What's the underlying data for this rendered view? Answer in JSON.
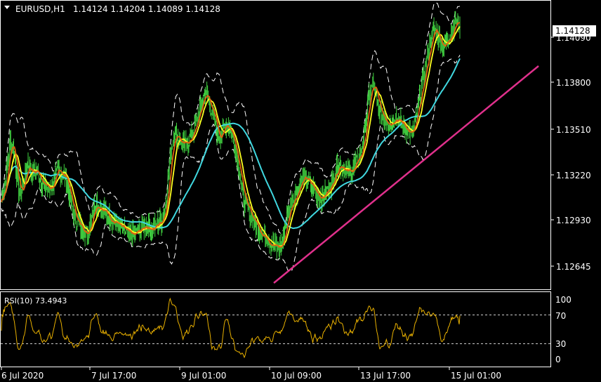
{
  "header": {
    "symbol": "EURUSD,H1",
    "ohlc": "1.14124 1.14204 1.14089 1.14128"
  },
  "rsi_header": {
    "label": "RSI(10) 73.4943"
  },
  "colors": {
    "background": "#000000",
    "grid": "#ffffff",
    "candle": "#40d040",
    "ma_fast": "#e06010",
    "ma_slow": "#ffff20",
    "ma_long": "#40d8e0",
    "bollinger": "#ffffff",
    "trendline": "#e0308c",
    "rsi_line": "#e8b000",
    "price_tag_bg": "#ffffff",
    "price_tag_fg": "#000000"
  },
  "chart_data": {
    "type": "candlestick",
    "price_axis": {
      "ticks": [
        "1.14090",
        "1.13800",
        "1.13510",
        "1.13220",
        "1.12930",
        "1.12645"
      ],
      "current_price": "1.14128",
      "ylim": [
        1.1245,
        1.1427
      ]
    },
    "time_axis": {
      "labels": [
        "6 Jul 2020",
        "7 Jul 17:00",
        "9 Jul 01:00",
        "10 Jul 09:00",
        "13 Jul 17:00",
        "15 Jul 01:00"
      ]
    },
    "rsi": {
      "period": 10,
      "last_value": 73.4943,
      "levels": [
        "100",
        "70",
        "30",
        "0"
      ],
      "ylim": [
        0,
        100
      ]
    },
    "approx_close_path": [
      1.13,
      1.1315,
      1.134,
      1.133,
      1.1305,
      1.131,
      1.1325,
      1.1318,
      1.132,
      1.1315,
      1.131,
      1.1308,
      1.1312,
      1.132,
      1.1318,
      1.1315,
      1.13,
      1.129,
      1.1285,
      1.1282,
      1.128,
      1.1295,
      1.13,
      1.1295,
      1.1293,
      1.129,
      1.1288,
      1.1285,
      1.1282,
      1.128,
      1.1278,
      1.128,
      1.1282,
      1.1285,
      1.1284,
      1.1283,
      1.1286,
      1.1288,
      1.13,
      1.133,
      1.1345,
      1.134,
      1.1335,
      1.1338,
      1.1342,
      1.135,
      1.136,
      1.137,
      1.1362,
      1.1355,
      1.134,
      1.1345,
      1.135,
      1.1345,
      1.1335,
      1.132,
      1.13,
      1.1295,
      1.129,
      1.1285,
      1.128,
      1.1278,
      1.1275,
      1.1272,
      1.127,
      1.1275,
      1.129,
      1.13,
      1.1305,
      1.1312,
      1.1315,
      1.1312,
      1.1308,
      1.1305,
      1.1303,
      1.1306,
      1.131,
      1.1318,
      1.1325,
      1.1322,
      1.1318,
      1.132,
      1.1325,
      1.133,
      1.1345,
      1.1368,
      1.1375,
      1.136,
      1.1355,
      1.1352,
      1.135,
      1.1355,
      1.135,
      1.1348,
      1.1345,
      1.1342,
      1.1355,
      1.137,
      1.1385,
      1.14,
      1.141,
      1.1405,
      1.1398,
      1.1402,
      1.1408,
      1.1415,
      1.1412
    ]
  }
}
